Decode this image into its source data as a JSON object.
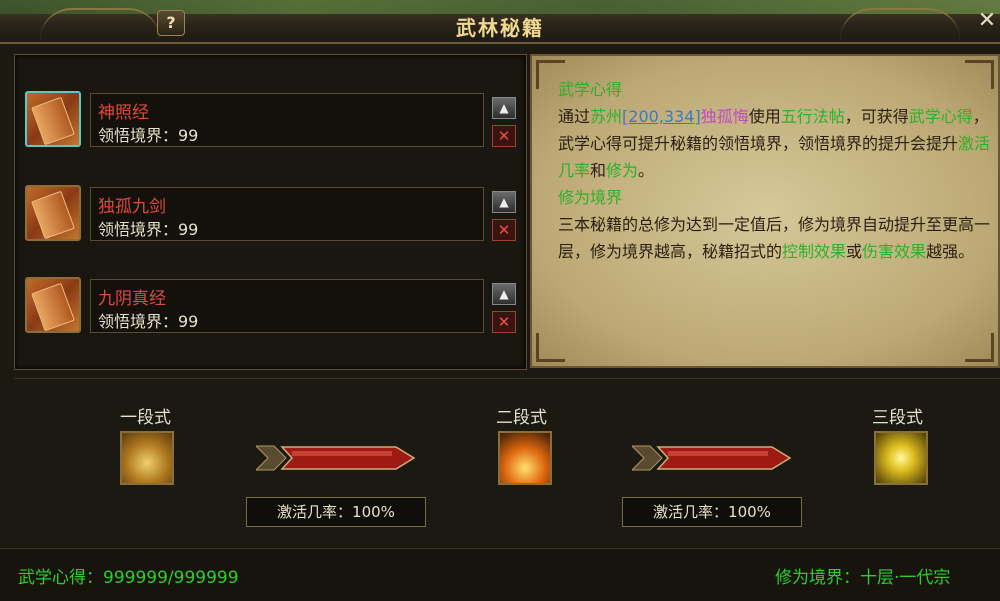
{
  "window": {
    "title": "武林秘籍",
    "help_label": "?",
    "close_label": "✕"
  },
  "books": [
    {
      "name": "神照经",
      "level_text": "领悟境界：99",
      "up_label": "▲",
      "delete_label": "✕",
      "selected": true
    },
    {
      "name": "独孤九剑",
      "level_text": "领悟境界：99",
      "up_label": "▲",
      "delete_label": "✕",
      "selected": false
    },
    {
      "name": "九阴真经",
      "level_text": "领悟境界：99",
      "up_label": "▲",
      "delete_label": "✕",
      "selected": false
    }
  ],
  "info": {
    "heading1": "武学心得",
    "p1_a": "通过",
    "p1_city": "苏州",
    "p1_coord": "[200,334]",
    "p1_npc": "独孤悔",
    "p1_b": "使用",
    "p1_item": "五行法帖",
    "p1_c": "，可获得",
    "p1_exp": "武学心得",
    "p1_d": "，武学心得可提升秘籍的领悟境界，领悟境界的提升会提升",
    "p1_rate": "激活几率",
    "p1_e": "和",
    "p1_cult": "修为",
    "p1_f": "。",
    "heading2": "修为境界",
    "p2_a": "三本秘籍的总修为达到一定值后，修为境界自动提升至更高一层，修为境界越高，秘籍招式的",
    "p2_ctrl": "控制效果",
    "p2_b": "或",
    "p2_dmg": "伤害效果",
    "p2_c": "越强。"
  },
  "stages": [
    {
      "label": "一段式"
    },
    {
      "label": "二段式"
    },
    {
      "label": "三段式"
    }
  ],
  "rates": [
    "激活几率：100%",
    "激活几率：100%"
  ],
  "footer": {
    "exp_text": "武学心得：999999/999999",
    "realm_text": "修为境界：十层·一代宗"
  },
  "colors": {
    "book_name": "#e04a3a",
    "highlight_green": "#2ab22a",
    "link_blue": "#3a7ac8",
    "npc_pink": "#c04ac4",
    "title_gold": "#f0d890"
  },
  "icons": {
    "help": "question-icon",
    "close": "close-icon",
    "up": "arrow-up-icon",
    "delete": "delete-icon"
  }
}
